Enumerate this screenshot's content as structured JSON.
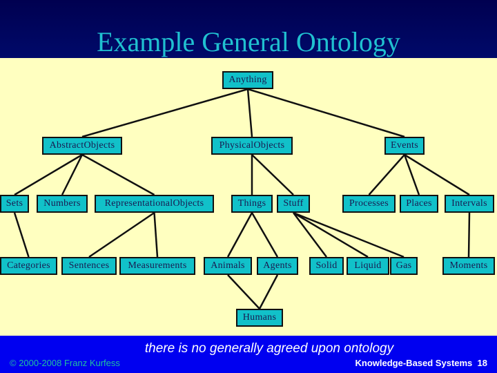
{
  "slide": {
    "title": "Example General Ontology",
    "caption": "there is no generally agreed upon ontology",
    "copyright": "© 2000-2008 Franz Kurfess",
    "course": "Knowledge-Based Systems",
    "page_number": "18"
  },
  "colors": {
    "header_bg": "#000050",
    "title": "#20c0d0",
    "canvas_bg": "#ffffc0",
    "node_fill": "#11c1c9",
    "node_border": "#101010",
    "footer_bg": "#0000f0"
  },
  "ontology": {
    "nodes": [
      {
        "id": "anything",
        "label": "Anything"
      },
      {
        "id": "abstract",
        "label": "AbstractObjects"
      },
      {
        "id": "physical",
        "label": "PhysicalObjects"
      },
      {
        "id": "events",
        "label": "Events"
      },
      {
        "id": "sets",
        "label": "Sets"
      },
      {
        "id": "numbers",
        "label": "Numbers"
      },
      {
        "id": "repr",
        "label": "RepresentationalObjects"
      },
      {
        "id": "things",
        "label": "Things"
      },
      {
        "id": "stuff",
        "label": "Stuff"
      },
      {
        "id": "processes",
        "label": "Processes"
      },
      {
        "id": "places",
        "label": "Places"
      },
      {
        "id": "intervals",
        "label": "Intervals"
      },
      {
        "id": "categories",
        "label": "Categories"
      },
      {
        "id": "sentences",
        "label": "Sentences"
      },
      {
        "id": "measurements",
        "label": "Measurements"
      },
      {
        "id": "animals",
        "label": "Animals"
      },
      {
        "id": "agents",
        "label": "Agents"
      },
      {
        "id": "solid",
        "label": "Solid"
      },
      {
        "id": "liquid",
        "label": "Liquid"
      },
      {
        "id": "gas",
        "label": "Gas"
      },
      {
        "id": "moments",
        "label": "Moments"
      },
      {
        "id": "humans",
        "label": "Humans"
      }
    ],
    "edges": [
      [
        "anything",
        "abstract"
      ],
      [
        "anything",
        "physical"
      ],
      [
        "anything",
        "events"
      ],
      [
        "abstract",
        "sets"
      ],
      [
        "abstract",
        "numbers"
      ],
      [
        "abstract",
        "repr"
      ],
      [
        "physical",
        "things"
      ],
      [
        "physical",
        "stuff"
      ],
      [
        "events",
        "processes"
      ],
      [
        "events",
        "places"
      ],
      [
        "events",
        "intervals"
      ],
      [
        "sets",
        "categories"
      ],
      [
        "repr",
        "sentences"
      ],
      [
        "repr",
        "measurements"
      ],
      [
        "things",
        "animals"
      ],
      [
        "things",
        "agents"
      ],
      [
        "stuff",
        "solid"
      ],
      [
        "stuff",
        "liquid"
      ],
      [
        "stuff",
        "gas"
      ],
      [
        "intervals",
        "moments"
      ],
      [
        "animals",
        "humans"
      ],
      [
        "agents",
        "humans"
      ]
    ]
  }
}
